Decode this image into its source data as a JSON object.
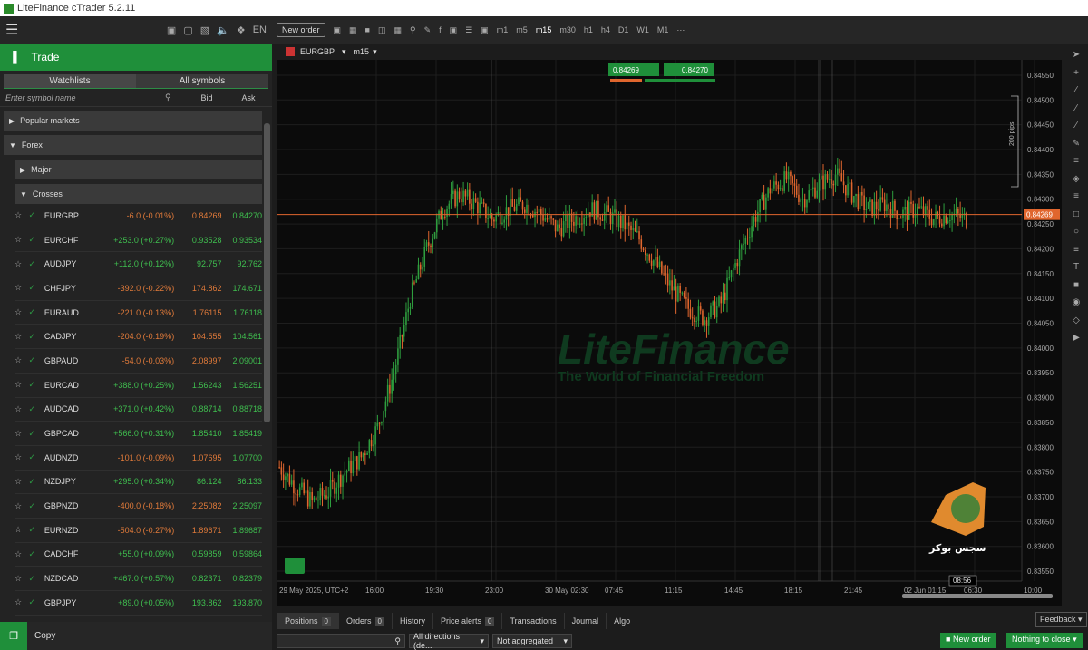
{
  "app": {
    "title": "LiteFinance cTrader 5.2.11"
  },
  "sidebar": {
    "trade_label": "Trade",
    "tabs": [
      "Watchlists",
      "All symbols"
    ],
    "search_placeholder": "Enter symbol name",
    "col_bid": "Bid",
    "col_ask": "Ask",
    "groups": {
      "popular": "Popular markets",
      "forex": "Forex",
      "major": "Major",
      "crosses": "Crosses"
    },
    "symbols": [
      {
        "sym": "EURGBP",
        "chg": "-6.0 (-0.01%)",
        "bid": "0.84269",
        "ask": "0.84270",
        "dir": "neg"
      },
      {
        "sym": "EURCHF",
        "chg": "+253.0 (+0.27%)",
        "bid": "0.93528",
        "ask": "0.93534",
        "dir": "pos"
      },
      {
        "sym": "AUDJPY",
        "chg": "+112.0 (+0.12%)",
        "bid": "92.757",
        "ask": "92.762",
        "dir": "pos"
      },
      {
        "sym": "CHFJPY",
        "chg": "-392.0 (-0.22%)",
        "bid": "174.862",
        "ask": "174.671",
        "dir": "neg"
      },
      {
        "sym": "EURAUD",
        "chg": "-221.0 (-0.13%)",
        "bid": "1.76115",
        "ask": "1.76118",
        "dir": "neg"
      },
      {
        "sym": "CADJPY",
        "chg": "-204.0 (-0.19%)",
        "bid": "104.555",
        "ask": "104.561",
        "dir": "neg"
      },
      {
        "sym": "GBPAUD",
        "chg": "-54.0 (-0.03%)",
        "bid": "2.08997",
        "ask": "2.09001",
        "dir": "neg"
      },
      {
        "sym": "EURCAD",
        "chg": "+388.0 (+0.25%)",
        "bid": "1.56243",
        "ask": "1.56251",
        "dir": "pos"
      },
      {
        "sym": "AUDCAD",
        "chg": "+371.0 (+0.42%)",
        "bid": "0.88714",
        "ask": "0.88718",
        "dir": "pos"
      },
      {
        "sym": "GBPCAD",
        "chg": "+566.0 (+0.31%)",
        "bid": "1.85410",
        "ask": "1.85419",
        "dir": "pos"
      },
      {
        "sym": "AUDNZD",
        "chg": "-101.0 (-0.09%)",
        "bid": "1.07695",
        "ask": "1.07700",
        "dir": "neg"
      },
      {
        "sym": "NZDJPY",
        "chg": "+295.0 (+0.34%)",
        "bid": "86.124",
        "ask": "86.133",
        "dir": "pos"
      },
      {
        "sym": "GBPNZD",
        "chg": "-400.0 (-0.18%)",
        "bid": "2.25082",
        "ask": "2.25097",
        "dir": "neg"
      },
      {
        "sym": "EURNZD",
        "chg": "-504.0 (-0.27%)",
        "bid": "1.89671",
        "ask": "1.89687",
        "dir": "neg"
      },
      {
        "sym": "CADCHF",
        "chg": "+55.0 (+0.09%)",
        "bid": "0.59859",
        "ask": "0.59864",
        "dir": "pos"
      },
      {
        "sym": "NZDCAD",
        "chg": "+467.0 (+0.57%)",
        "bid": "0.82371",
        "ask": "0.82379",
        "dir": "pos"
      },
      {
        "sym": "GBPJPY",
        "chg": "+89.0 (+0.05%)",
        "bid": "193.862",
        "ask": "193.870",
        "dir": "pos"
      }
    ],
    "copy_label": "Copy"
  },
  "toolbar": {
    "new_order_label": "New order",
    "timeframes": [
      "m1",
      "m5",
      "m15",
      "m30",
      "h1",
      "h4",
      "D1",
      "W1",
      "M1"
    ]
  },
  "chart": {
    "symbol": "EURGBP",
    "timeframe": "m15",
    "sell_price": "0.84269",
    "buy_price": "0.84270",
    "current_price": "0.84269",
    "pips_label": "200 pips",
    "watermark_brand": "LiteFinance",
    "watermark_tagline": "The World of Financial Freedom",
    "overlay_text": "سجس بوكر",
    "countdown": "08:56",
    "y_ticks": [
      "0.84550",
      "0.84500",
      "0.84450",
      "0.84400",
      "0.84350",
      "0.84300",
      "0.84250",
      "0.84200",
      "0.84150",
      "0.84100",
      "0.84050",
      "0.84000",
      "0.83950",
      "0.83900",
      "0.83850",
      "0.83800",
      "0.83750",
      "0.83700",
      "0.83650",
      "0.83600",
      "0.83550"
    ],
    "x_ticks": [
      "29 May 2025, UTC+2",
      "16:00",
      "19:30",
      "23:00",
      "30 May 02:30",
      "07:45",
      "11:15",
      "14:45",
      "18:15",
      "21:45",
      "02 Jun 01:15",
      "06:30",
      "10:00"
    ],
    "colors": {
      "up": "#2e9e3e",
      "down": "#e0662e",
      "price_line": "#e0662e",
      "accent": "#1f8f3a"
    }
  },
  "chart_data": {
    "type": "candlestick",
    "title": "",
    "symbol": "EURGBP",
    "timeframe": "m15",
    "ylim": [
      0.8353,
      0.8457
    ],
    "xlabel": "",
    "ylabel": "",
    "x_labels": [
      "29 May 2025, UTC+2",
      "16:00",
      "19:30",
      "23:00",
      "30 May 02:30",
      "07:45",
      "11:15",
      "14:45",
      "18:15",
      "21:45",
      "02 Jun 01:15",
      "06:30",
      "10:00"
    ],
    "close_path": [
      0.8376,
      0.8372,
      0.8369,
      0.8371,
      0.8375,
      0.8378,
      0.8384,
      0.8395,
      0.841,
      0.842,
      0.8428,
      0.8431,
      0.8429,
      0.8426,
      0.8428,
      0.8429,
      0.8427,
      0.8424,
      0.8426,
      0.8428,
      0.8427,
      0.8425,
      0.8422,
      0.8417,
      0.8412,
      0.8408,
      0.8406,
      0.8409,
      0.8418,
      0.8426,
      0.8432,
      0.8434,
      0.843,
      0.8433,
      0.8435,
      0.8431,
      0.8428,
      0.8429,
      0.8427,
      0.8428,
      0.8426,
      0.8427,
      0.8426
    ]
  },
  "bottom": {
    "tabs": [
      {
        "label": "Positions",
        "badge": "0"
      },
      {
        "label": "Orders",
        "badge": "0"
      },
      {
        "label": "History",
        "badge": ""
      },
      {
        "label": "Price alerts",
        "badge": "0"
      },
      {
        "label": "Transactions",
        "badge": ""
      },
      {
        "label": "Journal",
        "badge": ""
      },
      {
        "label": "Algo",
        "badge": ""
      }
    ],
    "feedback_label": "Feedback",
    "direction_filter": "All directions (de...",
    "aggregation_filter": "Not aggregated",
    "new_order_label": "New order",
    "close_label": "Nothing to close"
  }
}
